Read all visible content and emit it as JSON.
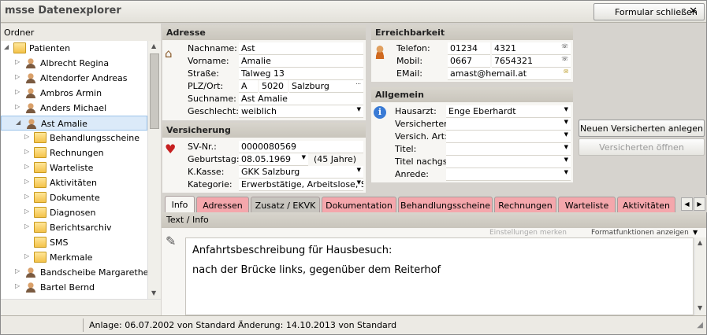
{
  "window": {
    "title": "msse Datenexplorer",
    "close_button": "Formular schließen"
  },
  "tree": {
    "header": "Ordner",
    "items": [
      {
        "label": "Patienten",
        "icon": "folder-icon",
        "level": 0,
        "expanded": true
      },
      {
        "label": "Albrecht Regina",
        "icon": "patient-icon",
        "level": 1
      },
      {
        "label": "Altendorfer Andreas",
        "icon": "patient-icon",
        "level": 1
      },
      {
        "label": "Ambros Armin",
        "icon": "patient-icon",
        "level": 1
      },
      {
        "label": "Anders Michael",
        "icon": "patient-icon",
        "level": 1
      },
      {
        "label": "Ast Amalie",
        "icon": "patient-icon",
        "level": 1,
        "selected": true,
        "expanded": true
      },
      {
        "label": "Behandlungsscheine",
        "icon": "folder-icon",
        "level": 2
      },
      {
        "label": "Rechnungen",
        "icon": "folder-icon",
        "level": 2
      },
      {
        "label": "Warteliste",
        "icon": "folder-icon",
        "level": 2
      },
      {
        "label": "Aktivitäten",
        "icon": "folder-icon",
        "level": 2
      },
      {
        "label": "Dokumente",
        "icon": "folder-icon",
        "level": 2
      },
      {
        "label": "Diagnosen",
        "icon": "folder-icon",
        "level": 2
      },
      {
        "label": "Berichtsarchiv",
        "icon": "folder-icon",
        "level": 2
      },
      {
        "label": "SMS",
        "icon": "folder-icon",
        "level": 2,
        "leaf": true
      },
      {
        "label": "Merkmale",
        "icon": "folder-icon",
        "level": 2
      },
      {
        "label": "Bandscheibe Margarethe",
        "icon": "patient-icon",
        "level": 1
      },
      {
        "label": "Bartel Bernd",
        "icon": "patient-icon",
        "level": 1
      }
    ]
  },
  "adresse": {
    "header": "Adresse",
    "nachname_label": "Nachname:",
    "nachname": "Ast",
    "vorname_label": "Vorname:",
    "vorname": "Amalie",
    "strasse_label": "Straße:",
    "strasse": "Talweg 13",
    "plz_label": "PLZ/Ort:",
    "land": "A",
    "plz": "5020",
    "ort": "Salzburg",
    "suchname_label": "Suchname:",
    "suchname": "Ast Amalie",
    "geschlecht_label": "Geschlecht:",
    "geschlecht": "weiblich"
  },
  "versicherung": {
    "header": "Versicherung",
    "svnr_label": "SV-Nr.:",
    "svnr": "0000080569",
    "geburtstag_label": "Geburtstag:",
    "geburtstag": "08.05.1969",
    "alter": "(45 Jahre)",
    "kkasse_label": "K.Kasse:",
    "kkasse": "GKK Salzburg",
    "kategorie_label": "Kategorie:",
    "kategorie": "Erwerbstätige, Arbeitslose, S"
  },
  "erreichbarkeit": {
    "header": "Erreichbarkeit",
    "telefon_label": "Telefon:",
    "telefon_vorwahl": "01234",
    "telefon_nr": "4321",
    "mobil_label": "Mobil:",
    "mobil_vorwahl": "0667",
    "mobil_nr": "7654321",
    "email_label": "EMail:",
    "email": "amast@hemail.at"
  },
  "allgemein": {
    "header": "Allgemein",
    "hausarzt_label": "Hausarzt:",
    "hausarzt": "Enge Eberhardt",
    "versicherter_label": "Versicherter:",
    "versicherter": "",
    "versich_art_label": "Versich. Art:",
    "versich_art": "",
    "titel_label": "Titel:",
    "titel": "",
    "titel_nachgst_label": "Titel nachgst.:",
    "titel_nachgst": "",
    "anrede_label": "Anrede:",
    "anrede": ""
  },
  "buttons": {
    "neu": "Neuen Versicherten anlegen",
    "oeffnen": "Versicherten öffnen"
  },
  "tabs": [
    {
      "label": "Info",
      "active": true
    },
    {
      "label": "Adressen"
    },
    {
      "label": "Zusatz / EKVK"
    },
    {
      "label": "Dokumentation"
    },
    {
      "label": "Behandlungsscheine"
    },
    {
      "label": "Rechnungen"
    },
    {
      "label": "Warteliste"
    },
    {
      "label": "Aktivitäten"
    }
  ],
  "info": {
    "header": "Text / Info",
    "einstellungen": "Einstellungen merken",
    "formatfunktionen": "Formatfunktionen anzeigen",
    "line1": "Anfahrtsbeschreibung für Hausbesuch:",
    "line2": "nach der Brücke links, gegenüber dem Reiterhof"
  },
  "status": {
    "text": "Anlage: 06.07.2002 von Standard  Änderung: 14.10.2013 von Standard"
  },
  "colors": {
    "tab_red": "#f4a7ac",
    "tab_gray": "#c8c5bf",
    "section_header": "#c9c5bc",
    "selection": "#dbeaf9"
  }
}
